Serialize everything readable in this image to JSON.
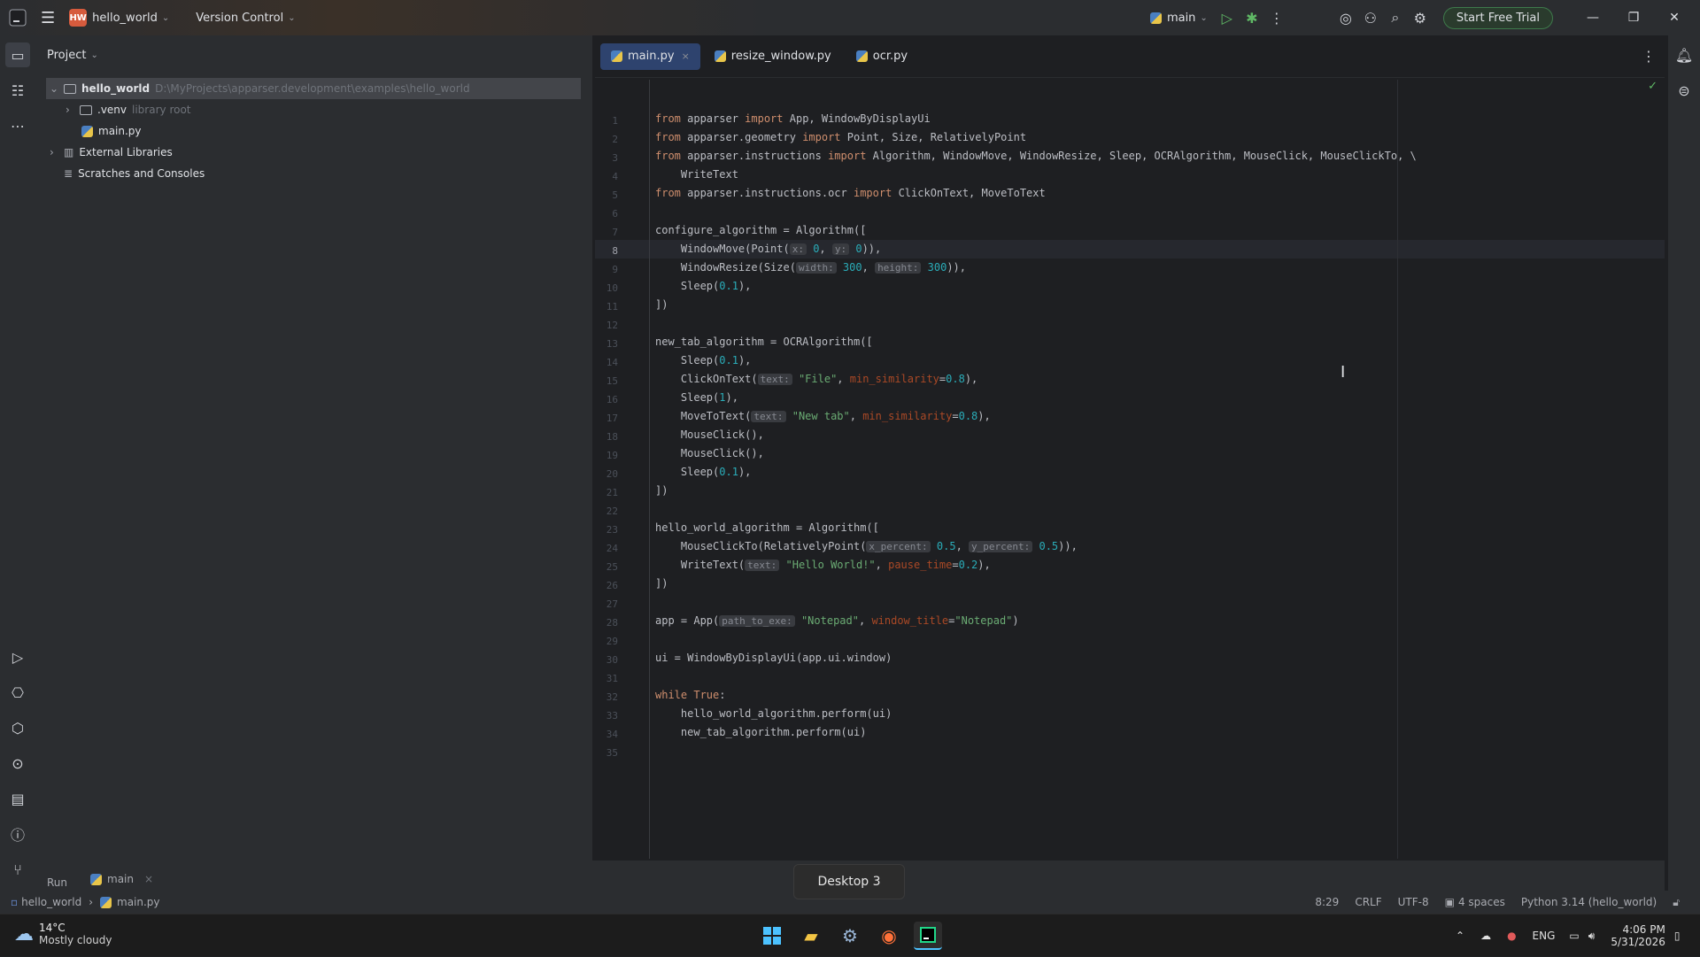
{
  "titlebar": {
    "project_badge": "HW",
    "project_name": "hello_world",
    "vcs_label": "Version Control",
    "run_config": "main",
    "trial_button": "Start Free Trial"
  },
  "project_panel": {
    "title": "Project",
    "tree": [
      {
        "label": "hello_world",
        "hint": "D:\\MyProjects\\apparser.development\\examples\\hello_world"
      },
      {
        "label": ".venv",
        "hint": "library root"
      },
      {
        "label": "main.py",
        "hint": ""
      },
      {
        "label": "External Libraries",
        "hint": ""
      },
      {
        "label": "Scratches and Consoles",
        "hint": ""
      }
    ]
  },
  "editor": {
    "tabs": [
      {
        "label": "main.py",
        "close": "×"
      },
      {
        "label": "resize_window.py"
      },
      {
        "label": "ocr.py"
      }
    ],
    "line_numbers": [
      "1",
      "2",
      "3",
      "4",
      "5",
      "6",
      "7",
      "8",
      "9",
      "10",
      "11",
      "12",
      "13",
      "14",
      "15",
      "16",
      "17",
      "18",
      "19",
      "20",
      "21",
      "22",
      "23",
      "24",
      "25",
      "26",
      "27",
      "28",
      "29",
      "30",
      "31",
      "32",
      "33",
      "34",
      "35"
    ],
    "code": {
      "l1": {
        "a": "from",
        "b": " apparser ",
        "c": "import",
        "d": " App, WindowByDisplayUi"
      },
      "l2": {
        "a": "from",
        "b": " apparser.geometry ",
        "c": "import",
        "d": " Point, Size, RelativelyPoint"
      },
      "l3": {
        "a": "from",
        "b": " apparser.instructions ",
        "c": "import",
        "d": " Algorithm, WindowMove, WindowResize, Sleep, OCRAlgorithm, MouseClick, MouseClickTo, \\"
      },
      "l4": {
        "a": "    WriteText"
      },
      "l5": {
        "a": "from",
        "b": " apparser.instructions.ocr ",
        "c": "import",
        "d": " ClickOnText, MoveToText"
      },
      "l7": {
        "a": "configure_algorithm = Algorithm(["
      },
      "l8": {
        "a": "    WindowMove(Point(",
        "h1": "x:",
        "n1": " 0",
        "s": ", ",
        "h2": "y:",
        "n2": " 0",
        "e": ")),"
      },
      "l9": {
        "a": "    WindowResize(Size(",
        "h1": "width:",
        "n1": " 300",
        "s": ", ",
        "h2": "height:",
        "n2": " 300",
        "e": ")),"
      },
      "l10": {
        "a": "    Sleep(",
        "n": "0.1",
        "e": "),"
      },
      "l11": {
        "a": "])"
      },
      "l13": {
        "a": "new_tab_algorithm = OCRAlgorithm(["
      },
      "l14": {
        "a": "    Sleep(",
        "n": "0.1",
        "e": "),"
      },
      "l15": {
        "a": "    ClickOnText(",
        "h": "text:",
        "s": " \"File\"",
        "c": ", ",
        "p": "min_similarity",
        "q": "=",
        "n": "0.8",
        "e": "),"
      },
      "l16": {
        "a": "    Sleep(",
        "n": "1",
        "e": "),"
      },
      "l17": {
        "a": "    MoveToText(",
        "h": "text:",
        "s": " \"New tab\"",
        "c": ", ",
        "p": "min_similarity",
        "q": "=",
        "n": "0.8",
        "e": "),"
      },
      "l18": {
        "a": "    MouseClick(),"
      },
      "l19": {
        "a": "    MouseClick(),"
      },
      "l20": {
        "a": "    Sleep(",
        "n": "0.1",
        "e": "),"
      },
      "l21": {
        "a": "])"
      },
      "l23": {
        "a": "hello_world_algorithm = Algorithm(["
      },
      "l24": {
        "a": "    MouseClickTo(RelativelyPoint(",
        "h1": "x_percent:",
        "n1": " 0.5",
        "s": ", ",
        "h2": "y_percent:",
        "n2": " 0.5",
        "e": ")),"
      },
      "l25": {
        "a": "    WriteText(",
        "h": "text:",
        "s": " \"Hello World!\"",
        "c": ", ",
        "p": "pause_time",
        "q": "=",
        "n": "0.2",
        "e": "),"
      },
      "l26": {
        "a": "])"
      },
      "l28": {
        "a": "app = App(",
        "h": "path_to_exe:",
        "s": " \"Notepad\"",
        "c": ", ",
        "p": "window_title",
        "q": "=",
        "s2": "\"Notepad\"",
        "e": ")"
      },
      "l30": {
        "a": "ui = WindowByDisplayUi(app.ui.window)"
      },
      "l32": {
        "a": "while",
        "b": " ",
        "c": "True",
        "d": ":"
      },
      "l33": {
        "a": "    hello_world_algorithm.perform(ui)"
      },
      "l34": {
        "a": "    new_tab_algorithm.perform(ui)"
      }
    }
  },
  "bottom_panel": {
    "run_label": "Run",
    "run_tab": "main"
  },
  "statusbar": {
    "breadcrumb_project": "hello_world",
    "breadcrumb_file": "main.py",
    "caret": "8:29",
    "line_sep": "CRLF",
    "encoding": "UTF-8",
    "indent": "4 spaces",
    "interpreter": "Python 3.14 (hello_world)"
  },
  "desktop_tooltip": "Desktop 3",
  "taskbar": {
    "weather_temp": "14°C",
    "weather_desc": "Mostly cloudy",
    "language": "ENG",
    "time": "4:06 PM",
    "date": "5/31/2026"
  }
}
